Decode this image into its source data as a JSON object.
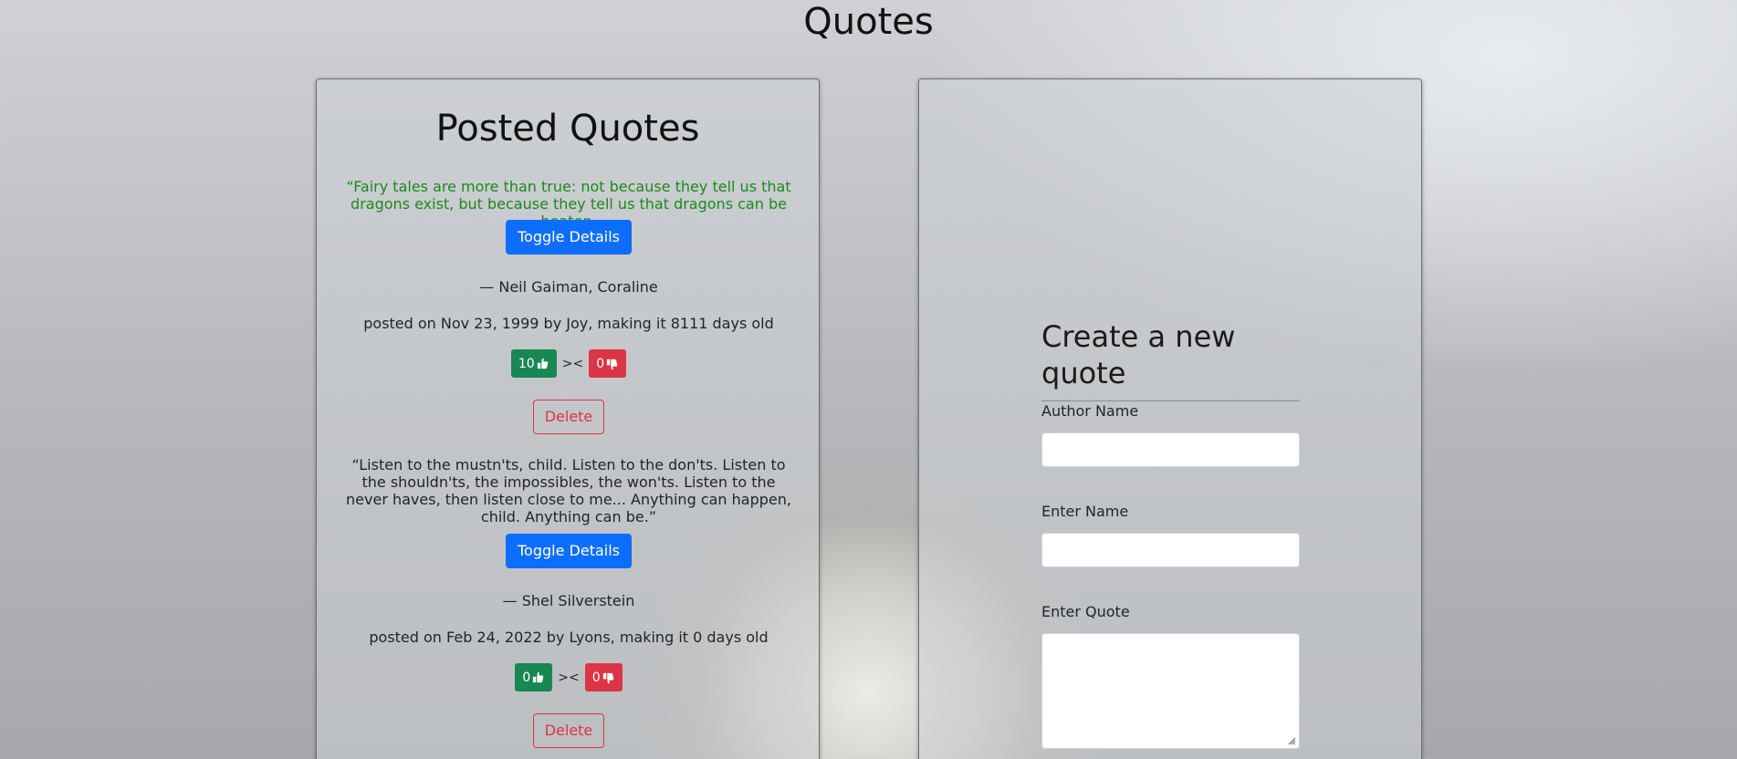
{
  "page": {
    "title": "Quotes"
  },
  "posted": {
    "title": "Posted Quotes",
    "quotes": [
      {
        "text": "“Fairy tales are more than true: not because they tell us that dragons exist, but because they tell us that dragons can be beaten.",
        "toggle_label": "Toggle Details",
        "author": "— Neil Gaiman, Coraline",
        "posted": "posted on Nov 23, 1999 by Joy, making it 8111 days old",
        "upvotes": "10",
        "separator": "><",
        "downvotes": "0",
        "delete_label": "Delete",
        "highlight_color": "#1a8a1a"
      },
      {
        "text": "“Listen to the mustn'ts, child. Listen to the don'ts. Listen to the shouldn'ts, the impossibles, the won'ts. Listen to the never haves, then listen close to me... Anything can happen, child. Anything can be.”",
        "toggle_label": "Toggle Details",
        "author": "— Shel Silverstein",
        "posted": "posted on Feb 24, 2022 by Lyons, making it 0 days old",
        "upvotes": "0",
        "separator": "><",
        "downvotes": "0",
        "delete_label": "Delete"
      }
    ]
  },
  "form": {
    "title": "Create a new quote",
    "author_label": "Author Name",
    "author_value": "",
    "name_label": "Enter Name",
    "name_value": "",
    "quote_label": "Enter Quote",
    "quote_value": ""
  },
  "colors": {
    "primary": "#0d6efd",
    "success": "#198754",
    "danger": "#dc3545"
  },
  "icons": [
    "thumbs-up-icon",
    "thumbs-down-icon",
    "resize-grip-icon"
  ]
}
